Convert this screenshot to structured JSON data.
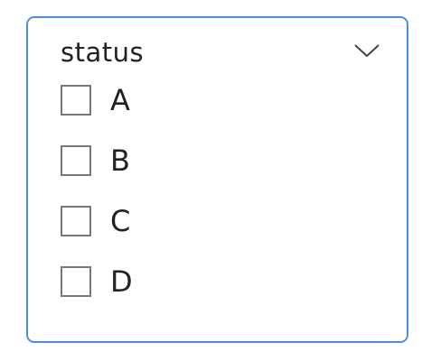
{
  "filter": {
    "title": "status",
    "expand_icon": "chevron-down-icon",
    "options": [
      {
        "label": "A",
        "checked": false
      },
      {
        "label": "B",
        "checked": false
      },
      {
        "label": "C",
        "checked": false
      },
      {
        "label": "D",
        "checked": false
      }
    ]
  },
  "colors": {
    "border": "#4a90e2",
    "checkbox_border": "#777777",
    "text": "#222222"
  }
}
